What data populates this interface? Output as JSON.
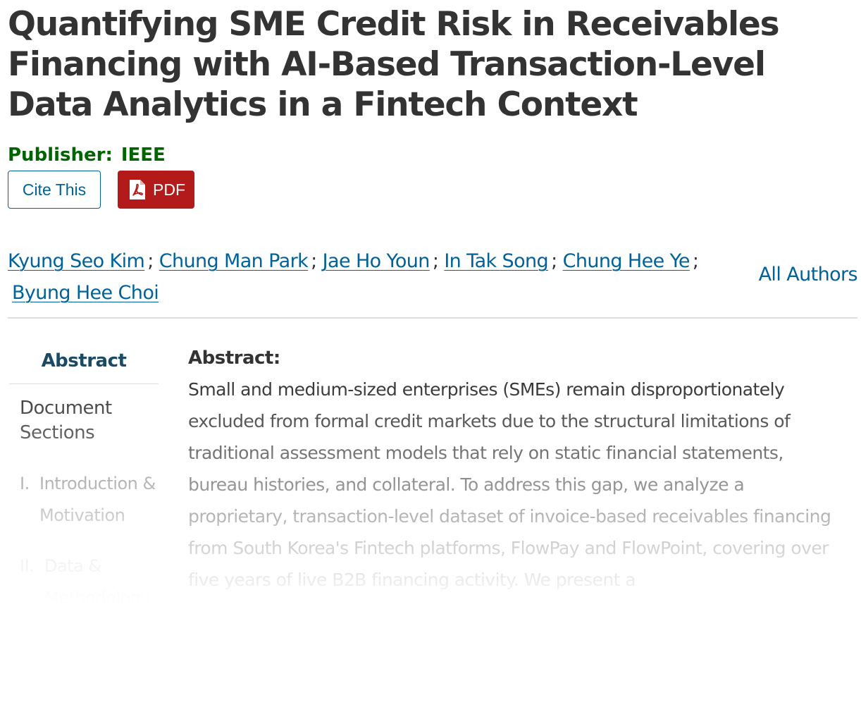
{
  "paper": {
    "title": "Quantifying SME Credit Risk in Receivables Financing with AI-Based Transaction-Level Data Analytics in a Fintech Context",
    "publisher_label": "Publisher:",
    "publisher_name": "IEEE"
  },
  "actions": {
    "cite_label": "Cite This",
    "pdf_label": "PDF",
    "pdf_icon": "pdf-file-icon"
  },
  "authors": {
    "list": [
      "Kyung Seo Kim",
      "Chung Man Park",
      "Jae Ho Youn",
      "In Tak Song",
      "Chung Hee Ye",
      "Byung Hee Choi"
    ],
    "separator": ";",
    "all_authors_label": "All Authors"
  },
  "sidenav": {
    "abstract_label": "Abstract",
    "doc_sections_label": "Document Sections",
    "sections": [
      {
        "number": "I.",
        "title": "Introduction & Motivation"
      },
      {
        "number": "II.",
        "title": "Data & Methodology"
      }
    ]
  },
  "abstract": {
    "label": "Abstract:",
    "text": "Small and medium-sized enterprises (SMEs) remain disproportionately excluded from formal credit markets due to the structural limitations of traditional assessment models that rely on static financial statements, bureau histories, and collateral. To address this gap, we analyze a proprietary, transaction-level dataset of invoice-based receivables financing from South Korea's Fintech platforms, FlowPay and FlowPoint, covering over five years of live B2B financing activity. We present a"
  },
  "colors": {
    "link": "#00629b",
    "publisher": "#006400",
    "pdf_button": "#b31b1b",
    "nav_active": "#1a4a66",
    "text": "#333333"
  }
}
